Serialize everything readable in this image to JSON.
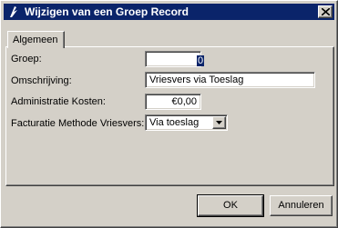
{
  "window": {
    "title": "Wijzigen van een Groep Record"
  },
  "tabs": [
    {
      "label": "Algemeen"
    }
  ],
  "form": {
    "groep": {
      "label": "Groep:",
      "value": "0"
    },
    "omschrijving": {
      "label": "Omschrijving:",
      "value": "Vriesvers via Toeslag"
    },
    "admin_kosten": {
      "label": "Administratie Kosten:",
      "value": "€0,00"
    },
    "facturatie": {
      "label": "Facturatie Methode Vriesvers:",
      "value": "Via toeslag"
    }
  },
  "buttons": {
    "ok": "OK",
    "cancel": "Annuleren"
  },
  "icons": {
    "app": "app-icon",
    "close": "close-icon",
    "dropdown": "chevron-down-icon"
  },
  "colors": {
    "titlebar": "#0a246a",
    "face": "#d4d0c8",
    "selection": "#0a246a"
  }
}
